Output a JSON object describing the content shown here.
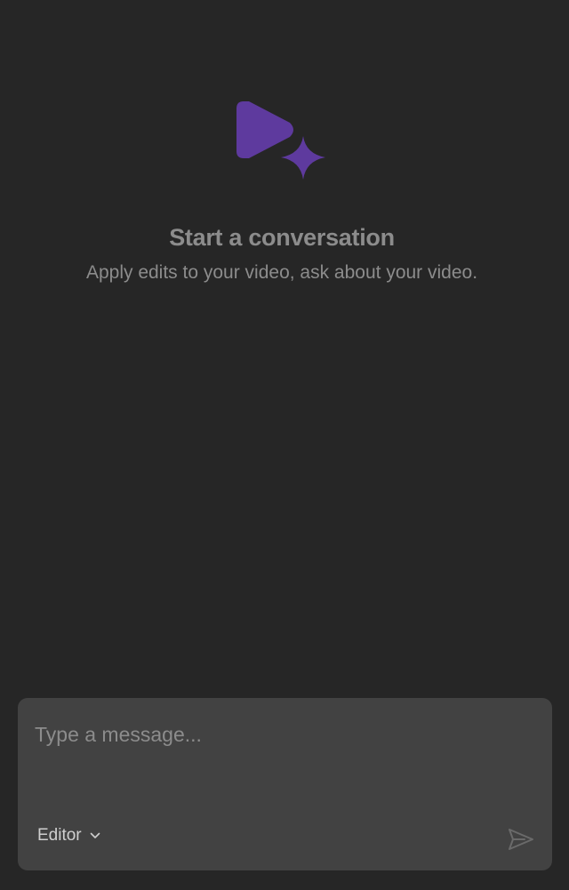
{
  "empty_state": {
    "logo_icon": "play-sparkle-icon",
    "title": "Start a conversation",
    "subtitle": "Apply edits to your video, ask about your video."
  },
  "composer": {
    "placeholder": "Type a message...",
    "value": "",
    "mode_label": "Editor",
    "mode_icon": "chevron-down-icon",
    "send_icon": "send-icon"
  },
  "colors": {
    "background": "#262626",
    "composer_background": "#424242",
    "accent": "#5e3a9e",
    "muted_text": "#8c8c8c"
  }
}
